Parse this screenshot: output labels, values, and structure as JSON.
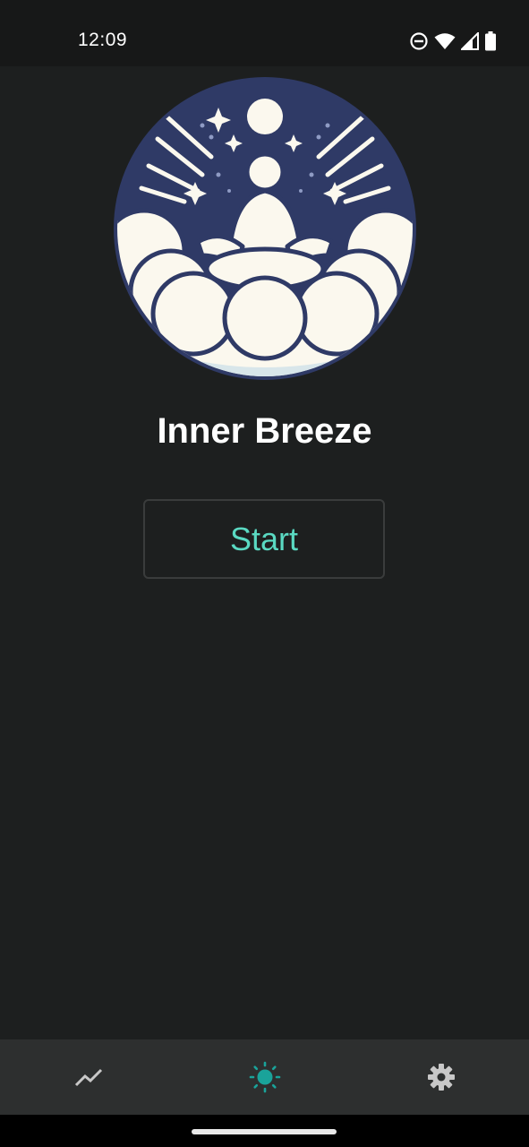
{
  "status_bar": {
    "time": "12:09",
    "icons": [
      "do-not-disturb-icon",
      "wifi-icon",
      "signal-icon",
      "battery-icon"
    ]
  },
  "main": {
    "logo_icon": "meditation-logo-icon",
    "title": "Inner Breeze",
    "start_label": "Start"
  },
  "bottom_nav": {
    "items": [
      {
        "icon": "progress-chart-icon",
        "active": false
      },
      {
        "icon": "breathe-sun-icon",
        "active": true
      },
      {
        "icon": "settings-gear-icon",
        "active": false
      }
    ]
  },
  "colors": {
    "background": "#1d1f1f",
    "accent": "#5ad9c2",
    "nav_active": "#1aa39a",
    "nav_inactive": "#c8c8c8",
    "logo_navy": "#2f3a66",
    "logo_cream": "#fbf8ee"
  }
}
